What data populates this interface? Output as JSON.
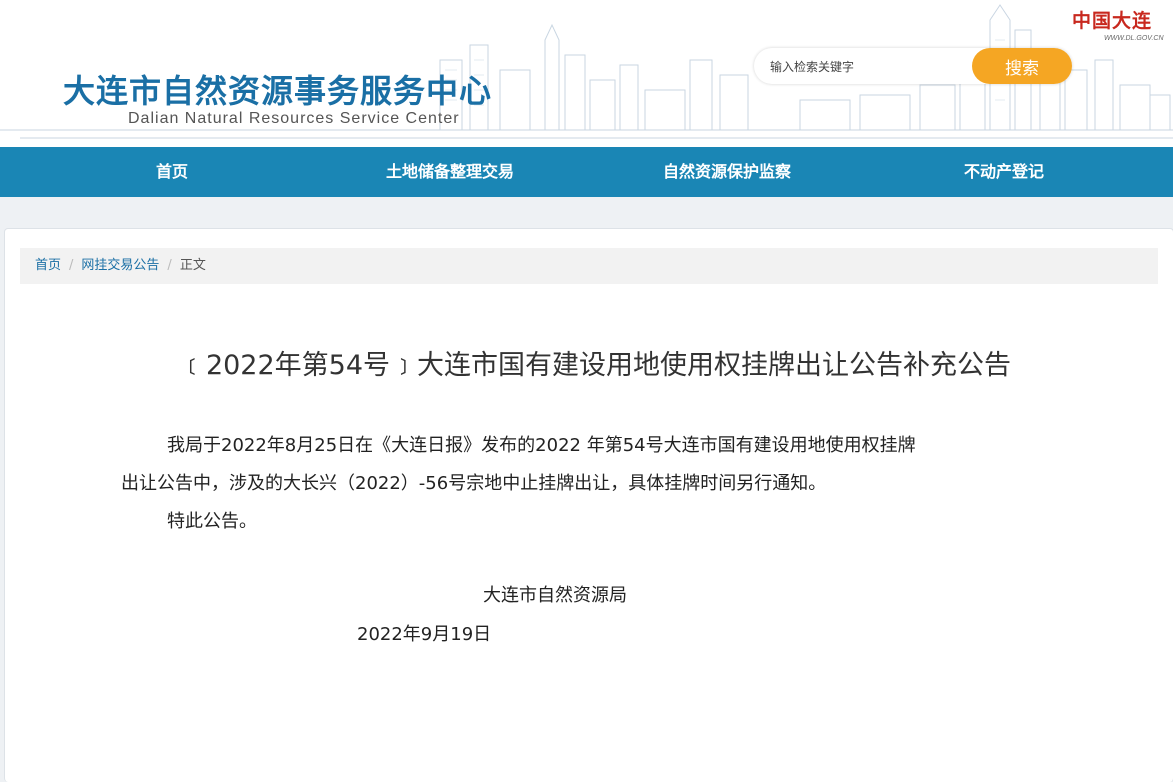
{
  "header": {
    "title": "大连市自然资源事务服务中心",
    "subtitle": "Dalian Natural Resources Service Center",
    "search": {
      "placeholder": "输入检索关键字",
      "button_label": "搜索"
    },
    "logo": {
      "text": "中国大连",
      "url": "WWW.DL.GOV.CN"
    }
  },
  "nav": {
    "items": [
      {
        "label": "首页"
      },
      {
        "label": "土地储备整理交易"
      },
      {
        "label": "自然资源保护监察"
      },
      {
        "label": "不动产登记"
      }
    ]
  },
  "breadcrumb": {
    "items": [
      "首页",
      "网挂交易公告"
    ],
    "current": "正文"
  },
  "article": {
    "title": "﹝2022年第54号﹞大连市国有建设用地使用权挂牌出让公告补充公告",
    "body_line1": "我局于2022年8月25日在《大连日报》发布的2022 年第54号大连市国有建设用地使用权挂牌",
    "body_line2": "出让公告中，涉及的大长兴（2022）-56号宗地中止挂牌出让，具体挂牌时间另行通知。",
    "closing": "特此公告。",
    "signature": "大连市自然资源局",
    "date": "2022年9月19日"
  },
  "colors": {
    "title_blue": "#1a6fa5",
    "nav_bg": "#1a86b5",
    "search_button": "#f5a623",
    "logo_red": "#c8281e"
  }
}
